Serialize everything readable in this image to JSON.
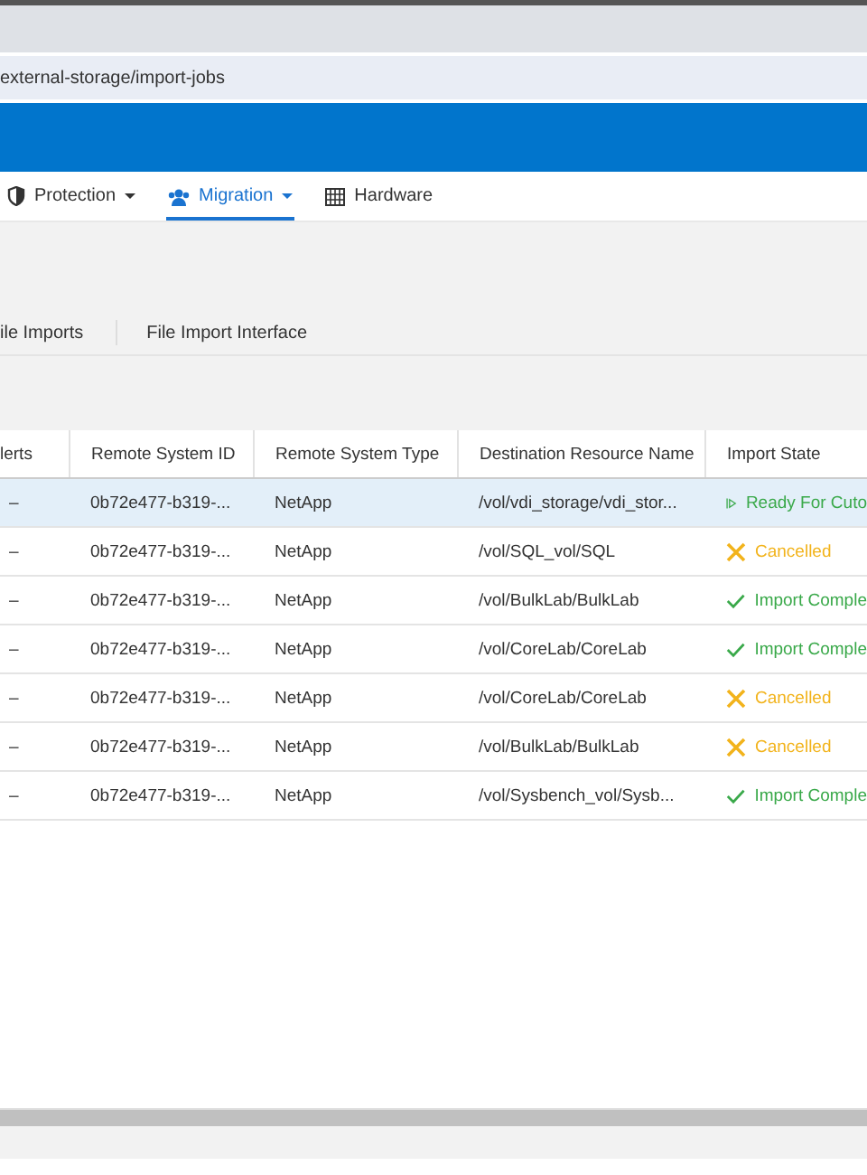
{
  "browser": {
    "address": "external-storage/import-jobs"
  },
  "nav": [
    {
      "label": "Protection",
      "has_menu": true,
      "selected": false
    },
    {
      "label": "Migration",
      "has_menu": true,
      "selected": true
    },
    {
      "label": "Hardware",
      "has_menu": false,
      "selected": false
    }
  ],
  "subtabs": [
    {
      "label": "ile Imports"
    },
    {
      "label": "File Import Interface"
    }
  ],
  "table": {
    "columns": [
      "lerts",
      "Remote System ID",
      "Remote System Type",
      "Destination Resource Name",
      "Import State"
    ],
    "rows": [
      {
        "selected": true,
        "alerts": "–",
        "remote_id": "0b72e477-b319-...",
        "remote_type": "NetApp",
        "destination": "/vol/vdi_storage/vdi_stor...",
        "state": {
          "kind": "ready",
          "label": "Ready For Cuto"
        }
      },
      {
        "selected": false,
        "alerts": "–",
        "remote_id": "0b72e477-b319-...",
        "remote_type": "NetApp",
        "destination": "/vol/SQL_vol/SQL",
        "state": {
          "kind": "cancelled",
          "label": "Cancelled"
        }
      },
      {
        "selected": false,
        "alerts": "–",
        "remote_id": "0b72e477-b319-...",
        "remote_type": "NetApp",
        "destination": "/vol/BulkLab/BulkLab",
        "state": {
          "kind": "complete",
          "label": "Import Comple"
        }
      },
      {
        "selected": false,
        "alerts": "–",
        "remote_id": "0b72e477-b319-...",
        "remote_type": "NetApp",
        "destination": "/vol/CoreLab/CoreLab",
        "state": {
          "kind": "complete",
          "label": "Import Comple"
        }
      },
      {
        "selected": false,
        "alerts": "–",
        "remote_id": "0b72e477-b319-...",
        "remote_type": "NetApp",
        "destination": "/vol/CoreLab/CoreLab",
        "state": {
          "kind": "cancelled",
          "label": "Cancelled"
        }
      },
      {
        "selected": false,
        "alerts": "–",
        "remote_id": "0b72e477-b319-...",
        "remote_type": "NetApp",
        "destination": "/vol/BulkLab/BulkLab",
        "state": {
          "kind": "cancelled",
          "label": "Cancelled"
        }
      },
      {
        "selected": false,
        "alerts": "–",
        "remote_id": "0b72e477-b319-...",
        "remote_type": "NetApp",
        "destination": "/vol/Sysbench_vol/Sysb...",
        "state": {
          "kind": "complete",
          "label": "Import Comple"
        }
      }
    ]
  }
}
